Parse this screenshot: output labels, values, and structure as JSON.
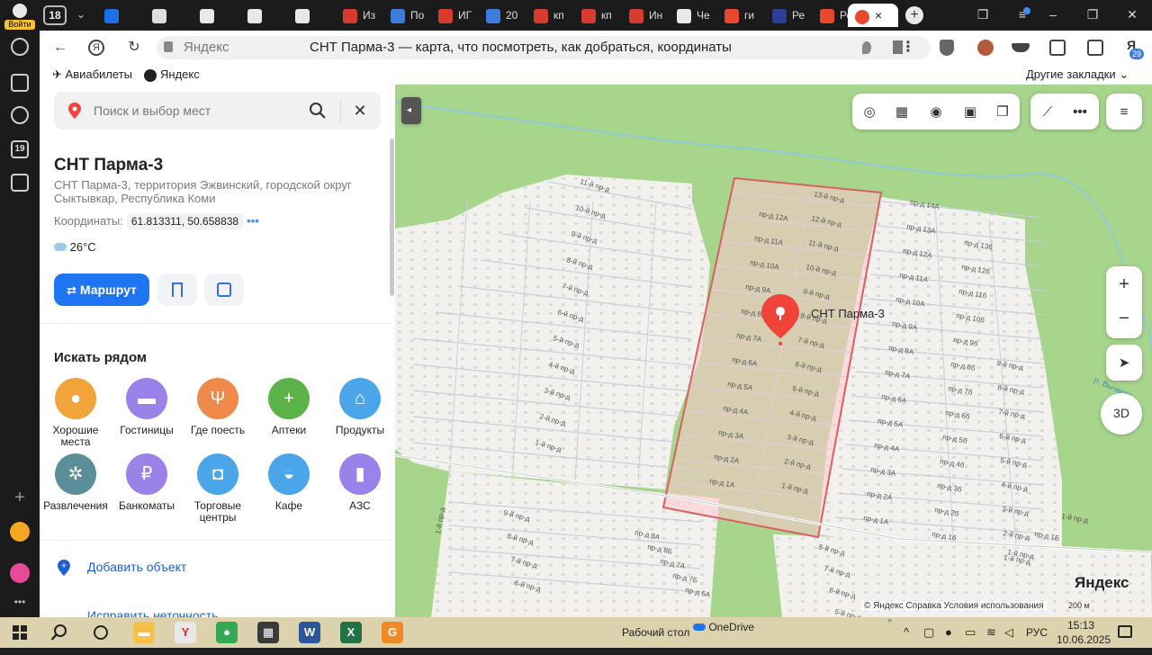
{
  "sidebar": {
    "login_label": "Войти",
    "badge_19": "19"
  },
  "tabs": {
    "count": "18",
    "items": [
      {
        "label": "",
        "color": "#1e6fe8"
      },
      {
        "label": "",
        "color": "#dddddd"
      },
      {
        "label": "",
        "color": "#e8e8e8"
      },
      {
        "label": "",
        "color": "#e8e8e8"
      },
      {
        "label": "",
        "color": "#e8e8e8"
      },
      {
        "label": "Из",
        "color": "#d63b2e"
      },
      {
        "label": "По",
        "color": "#3b7ddd"
      },
      {
        "label": "ИГ",
        "color": "#d63b2e"
      },
      {
        "label": "20",
        "color": "#3b7ddd"
      },
      {
        "label": "кп",
        "color": "#d63b2e"
      },
      {
        "label": "кп",
        "color": "#d63b2e"
      },
      {
        "label": "Ин",
        "color": "#d63b2e"
      },
      {
        "label": "Че",
        "color": "#e8e8e8"
      },
      {
        "label": "ги",
        "color": "#e8482e"
      },
      {
        "label": "Ре",
        "color": "#2a3e9a"
      },
      {
        "label": "Ре",
        "color": "#e8482e"
      }
    ]
  },
  "omnibox": {
    "domain": "Яндекс",
    "title": "СНТ Парма-3 — карта, что посмотреть, как добраться, координаты",
    "ext_badge": "29"
  },
  "bookmarks": {
    "items": [
      "Авиабилеты",
      "Яндекс"
    ],
    "other": "Другие закладки"
  },
  "panel": {
    "search_placeholder": "Поиск и выбор мест",
    "title": "СНТ Парма-3",
    "address": "СНТ Парма-3, территория Эжвинский, городской округ Сыктывкар, Республика Коми",
    "coords_label": "Координаты:",
    "coords_value": "61.813311, 50.658838",
    "coords_more": "•••",
    "weather": "26°C",
    "route_label": "Маршрут",
    "nearby_title": "Искать рядом",
    "categories": [
      {
        "label": "Хорошие места",
        "icon": "pin-star-icon",
        "color": "#f2a33a"
      },
      {
        "label": "Гостиницы",
        "icon": "bed-icon",
        "color": "#9b82e8"
      },
      {
        "label": "Где поесть",
        "icon": "fork-knife-icon",
        "color": "#f08a4b"
      },
      {
        "label": "Аптеки",
        "icon": "pharmacy-cross-icon",
        "color": "#5bb34a"
      },
      {
        "label": "Продукты",
        "icon": "basket-icon",
        "color": "#4aa6e8"
      },
      {
        "label": "Развлечения",
        "icon": "ferris-wheel-icon",
        "color": "#5a8f9a"
      },
      {
        "label": "Банкоматы",
        "icon": "ruble-icon",
        "color": "#9b82e8"
      },
      {
        "label": "Торговые центры",
        "icon": "shopping-bag-icon",
        "color": "#4aa6e8"
      },
      {
        "label": "Кафе",
        "icon": "cup-icon",
        "color": "#4aa6e8"
      },
      {
        "label": "АЗС",
        "icon": "fuel-icon",
        "color": "#9b82e8"
      }
    ],
    "add_object": "Добавить объект",
    "fix_inaccuracy": "Исправить неточность"
  },
  "map": {
    "pin_label": "СНТ Парма-3",
    "logo": "Яндекс",
    "attribution": "© Яндекс  Справка  Условия использования",
    "scale": "200 м",
    "btn_3d": "3D",
    "river_label": "р. Вычегда",
    "streets_left": [
      "11-й пр-д",
      "10-й пр-д",
      "9-й пр-д",
      "8-й пр-д",
      "7-й пр-д",
      "6-й пр-д",
      "5-й пр-д",
      "4-й пр-д",
      "3-й пр-д",
      "2-й пр-д",
      "1-й пр-д"
    ],
    "streets_center": [
      "13-й пр-д",
      "12-й пр-д",
      "11-й пр-д",
      "10-й пр-д",
      "9-й пр-д",
      "8-й пр-д",
      "7-й пр-д",
      "6-й пр-д",
      "5-й пр-д",
      "4-й пр-д",
      "3-й пр-д",
      "2-й пр-д",
      "1-й пр-д"
    ],
    "streets_center_a": [
      "пр-д 12А",
      "пр-д 11А",
      "пр-д 10А",
      "пр-д 9А",
      "пр-д 8А",
      "пр-д 7А",
      "пр-д 6А",
      "пр-д 5А",
      "пр-д 4А",
      "пр-д 3А",
      "пр-д 2А",
      "пр-д 1А"
    ],
    "streets_right_a": [
      "пр-д 14А",
      "пр-д 13А",
      "пр-д 12А",
      "пр-д 11А",
      "пр-д 10А",
      "пр-д 9А",
      "пр-д 8А",
      "пр-д 7А",
      "пр-д 6А",
      "пр-д 5А",
      "пр-д 4А",
      "пр-д 3А",
      "пр-д 2А",
      "пр-д 1А"
    ],
    "streets_right_b": [
      "пр-д 13б",
      "пр-д 12б",
      "пр-д 11б",
      "пр-д 10б",
      "пр-д 9б",
      "пр-д 8б",
      "пр-д 7б",
      "пр-д 6б",
      "пр-д 5б",
      "пр-д 4б",
      "пр-д 3б",
      "пр-д 2б",
      "пр-д 1б"
    ],
    "streets_far_right": [
      "9-й пр-д",
      "8-й пр-д",
      "7-й пр-д",
      "6-й пр-д",
      "5-й пр-д",
      "4-й пр-д",
      "3-й пр-д",
      "2-й пр-д",
      "1-й пр-д"
    ],
    "streets_bottom": [
      "пр-д 8А",
      "пр-д 8Б",
      "пр-д 7А",
      "пр-д 7Б",
      "пр-д 6А"
    ],
    "streets_bottom_mid": [
      "8-й пр-д",
      "7-й пр-д",
      "6-й пр-д",
      "5-й пр-д"
    ],
    "streets_bottom_left": [
      "9-й пр-д",
      "8-й пр-д",
      "7-й пр-д",
      "6-й пр-д"
    ],
    "streets_bottom_right": [
      "1-й пр-д",
      "пр-д 1Б",
      "1-й пр-д"
    ],
    "street_vertical": "1-й пр-д"
  },
  "taskbar": {
    "desktop_label": "Рабочий стол",
    "onedrive": "OneDrive",
    "lang": "РУС",
    "time": "15:13",
    "date": "10.06.2025",
    "apps": [
      {
        "icon": "file-explorer-icon",
        "color": "#f3c04a"
      },
      {
        "icon": "yandex-browser-icon",
        "color": "#e8e8e8"
      },
      {
        "icon": "chrome-icon",
        "color": "#34a853"
      },
      {
        "icon": "calculator-icon",
        "color": "#3a3a3a"
      },
      {
        "icon": "word-icon",
        "color": "#2b579a"
      },
      {
        "icon": "excel-icon",
        "color": "#217346"
      },
      {
        "icon": "pdf-editor-icon",
        "color": "#f08a24"
      }
    ]
  }
}
